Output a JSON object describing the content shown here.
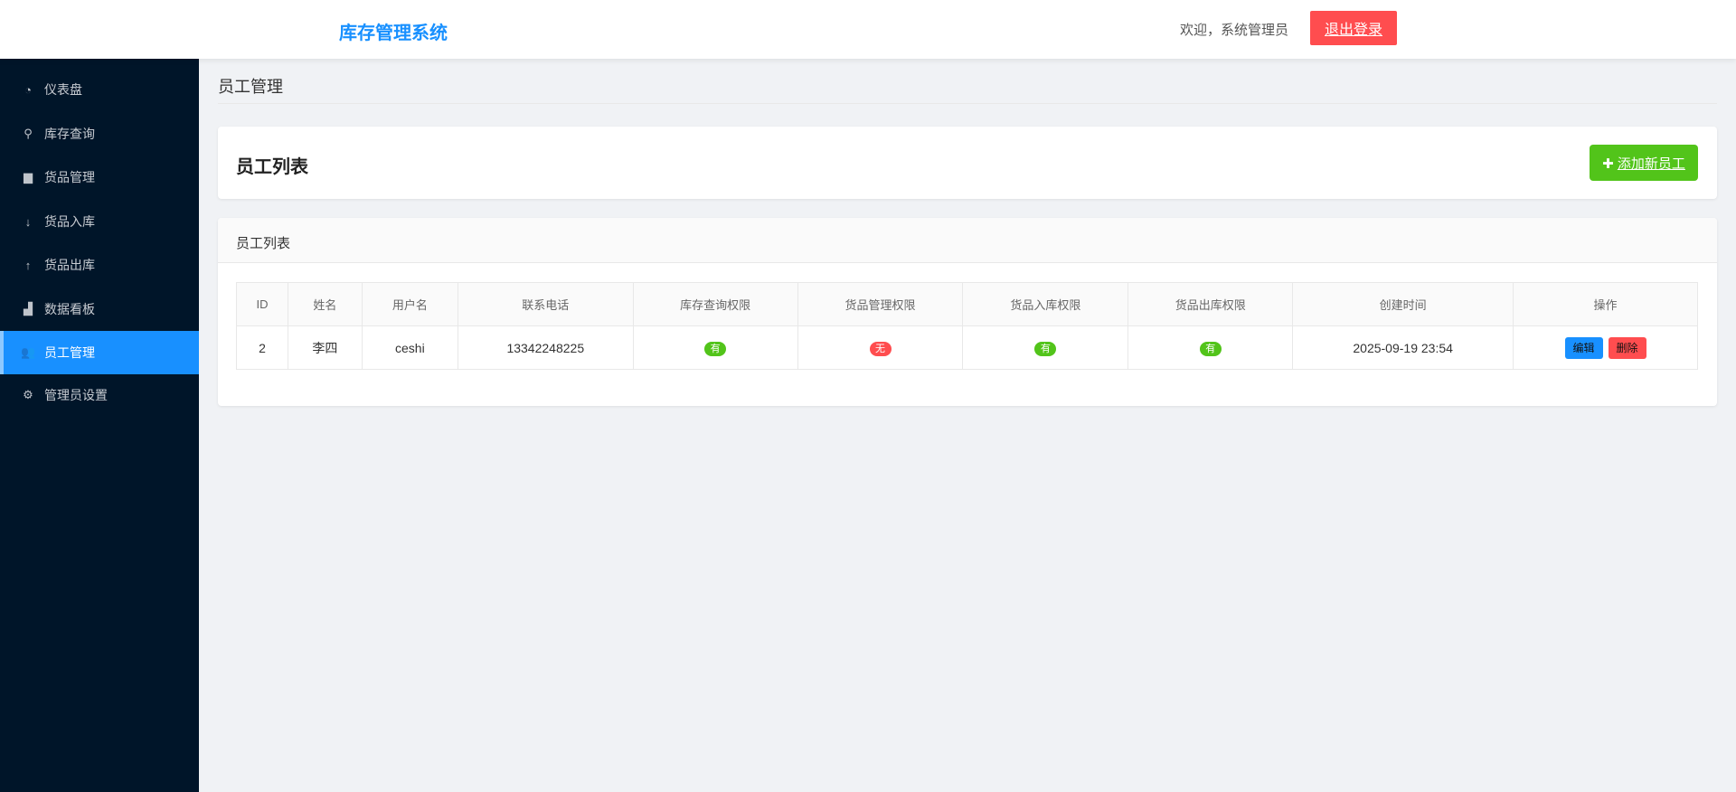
{
  "header": {
    "title": "库存管理系统",
    "welcome": "欢迎，系统管理员",
    "logout": "退出登录"
  },
  "sidebar": {
    "items": [
      {
        "label": "仪表盘",
        "icon": "dashboard-icon"
      },
      {
        "label": "库存查询",
        "icon": "search-icon"
      },
      {
        "label": "货品管理",
        "icon": "box-icon"
      },
      {
        "label": "货品入库",
        "icon": "arrow-down-icon"
      },
      {
        "label": "货品出库",
        "icon": "arrow-up-icon"
      },
      {
        "label": "数据看板",
        "icon": "bar-chart-icon"
      },
      {
        "label": "员工管理",
        "icon": "users-icon",
        "active": true
      },
      {
        "label": "管理员设置",
        "icon": "gear-icon"
      }
    ]
  },
  "page": {
    "title": "员工管理",
    "card_title": "员工列表",
    "add_button": "添加新员工",
    "list_title": "员工列表"
  },
  "table": {
    "columns": [
      "ID",
      "姓名",
      "用户名",
      "联系电话",
      "库存查询权限",
      "货品管理权限",
      "货品入库权限",
      "货品出库权限",
      "创建时间",
      "操作"
    ],
    "rows": [
      {
        "id": "2",
        "name": "李四",
        "username": "ceshi",
        "phone": "13342248225",
        "perm_query": "有",
        "perm_goods": "无",
        "perm_in": "有",
        "perm_out": "有",
        "created": "2025-09-19 23:54",
        "edit": "编辑",
        "delete": "删除"
      }
    ]
  },
  "colors": {
    "primary": "#1890ff",
    "success": "#52c41a",
    "danger": "#ff4d4f",
    "sidebar": "#001529"
  }
}
